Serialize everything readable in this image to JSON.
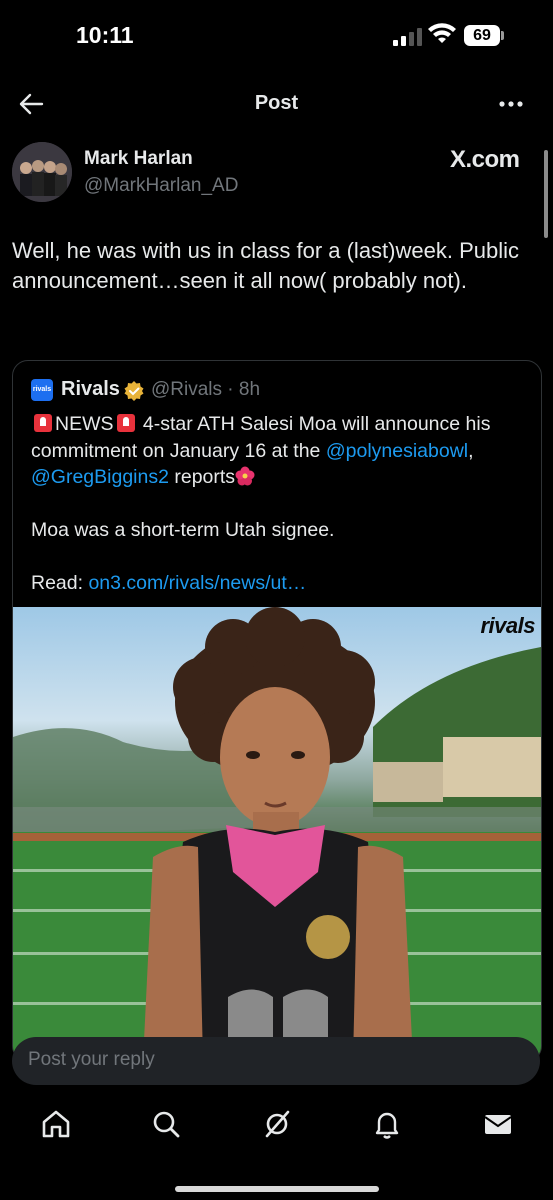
{
  "status_bar": {
    "time": "10:11",
    "battery": "69"
  },
  "nav": {
    "title": "Post"
  },
  "author": {
    "name": "Mark Harlan",
    "handle": "@MarkHarlan_AD",
    "source": "X.com"
  },
  "post": {
    "text": "Well, he was with us in class for a (last)week. Public announcement…seen it all now( probably not)."
  },
  "quote": {
    "logo_text": "rivals",
    "name": "Rivals",
    "handle_time": "@Rivals · 8h",
    "line1_a": "NEWS",
    "line1_b": "4-star ATH Salesi Moa will announce his commitment on January 16 at the ",
    "mention1": "@polynesiabowl",
    "sep": ",",
    "mention2": "@GregBiggins2",
    "line1_c": " reports",
    "line2": "Moa was a short-term Utah signee.",
    "read_label": "Read: ",
    "read_link": "on3.com/rivals/news/ut…",
    "image_watermark": "rivals"
  },
  "reply": {
    "placeholder": "Post your reply"
  },
  "colors": {
    "accent": "#1d9bf0",
    "background": "#000000",
    "muted": "#71767b",
    "badge": "#e8b339"
  },
  "icons": [
    "back-arrow-icon",
    "more-icon",
    "verified-badge-icon",
    "home-icon",
    "search-icon",
    "grok-icon",
    "bell-icon",
    "mail-icon"
  ]
}
